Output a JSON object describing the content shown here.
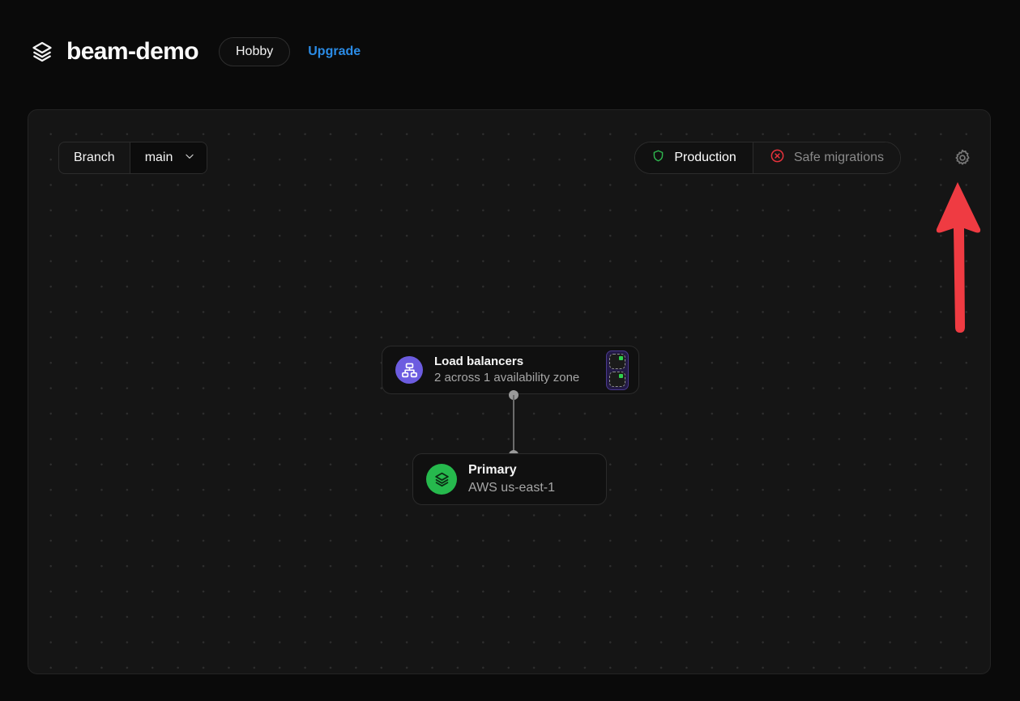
{
  "header": {
    "logo_icon": "layers-icon",
    "project_title": "beam-demo",
    "plan_badge": "Hobby",
    "upgrade_link": "Upgrade"
  },
  "canvas": {
    "branch": {
      "label": "Branch",
      "value": "main",
      "chevron_icon": "chevron-down-icon"
    },
    "status": {
      "environment_icon": "shield-icon",
      "environment_label": "Production",
      "migrations_icon": "circle-x-icon",
      "migrations_label": "Safe migrations"
    },
    "settings_icon": "gear-icon",
    "annotation": {
      "arrow_icon": "up-arrow-annotation",
      "color": "#ef3b42"
    },
    "nodes": [
      {
        "id": "load-balancers",
        "icon": "network-nodes-icon",
        "icon_color": "#6c5ce0",
        "title": "Load balancers",
        "subtitle": "2 across 1 availability zone",
        "replicas": [
          {
            "status_icon": "status-dot-healthy",
            "status_color": "#2fd14e"
          },
          {
            "status_icon": "status-dot-healthy",
            "status_color": "#2fd14e"
          }
        ]
      },
      {
        "id": "primary",
        "icon": "layers-icon",
        "icon_color": "#26b94d",
        "title": "Primary",
        "subtitle": "AWS us-east-1"
      }
    ],
    "connector": {
      "from": "load-balancers",
      "to": "primary"
    }
  },
  "colors": {
    "page_background": "#0a0a0a",
    "canvas_background": "#151515",
    "accent_link": "#2b8ce6",
    "status_ok": "#2fb84f",
    "status_error": "#e6323c",
    "annotation_red": "#ef3b42"
  }
}
